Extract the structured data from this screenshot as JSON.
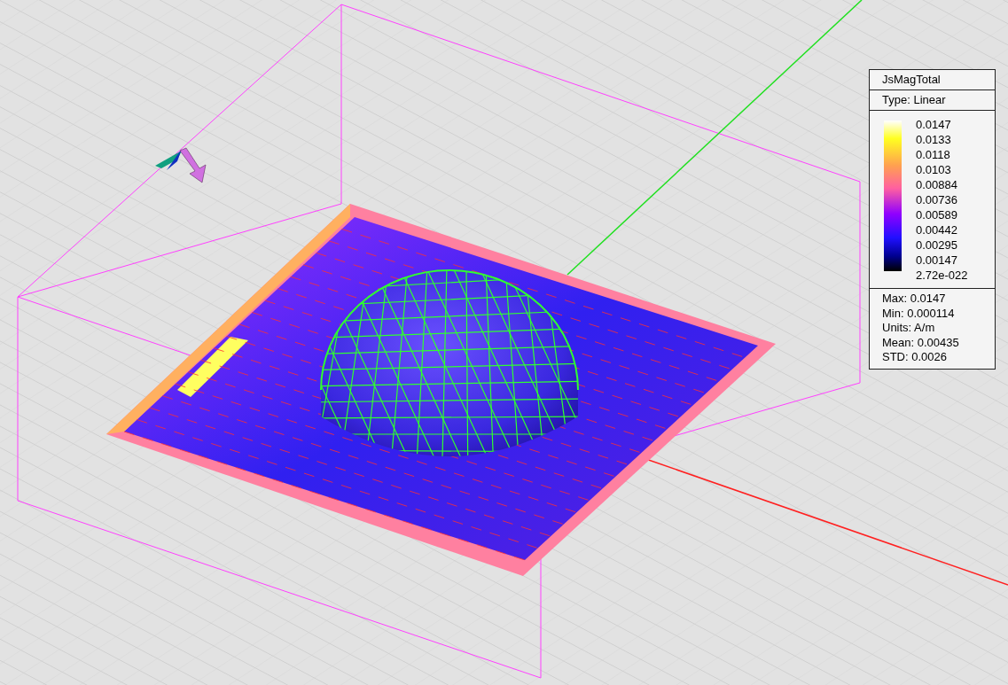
{
  "legend": {
    "title": "JsMagTotal",
    "type": "Type: Linear",
    "scale_labels": [
      "0.0147",
      "0.0133",
      "0.0118",
      "0.0103",
      "0.00884",
      "0.00736",
      "0.00589",
      "0.00442",
      "0.00295",
      "0.00147",
      "2.72e-022"
    ],
    "stats": [
      "Max: 0.0147",
      "Min: 0.000114",
      "Units: A/m",
      "Mean: 0.00435",
      "STD: 0.0026"
    ]
  }
}
